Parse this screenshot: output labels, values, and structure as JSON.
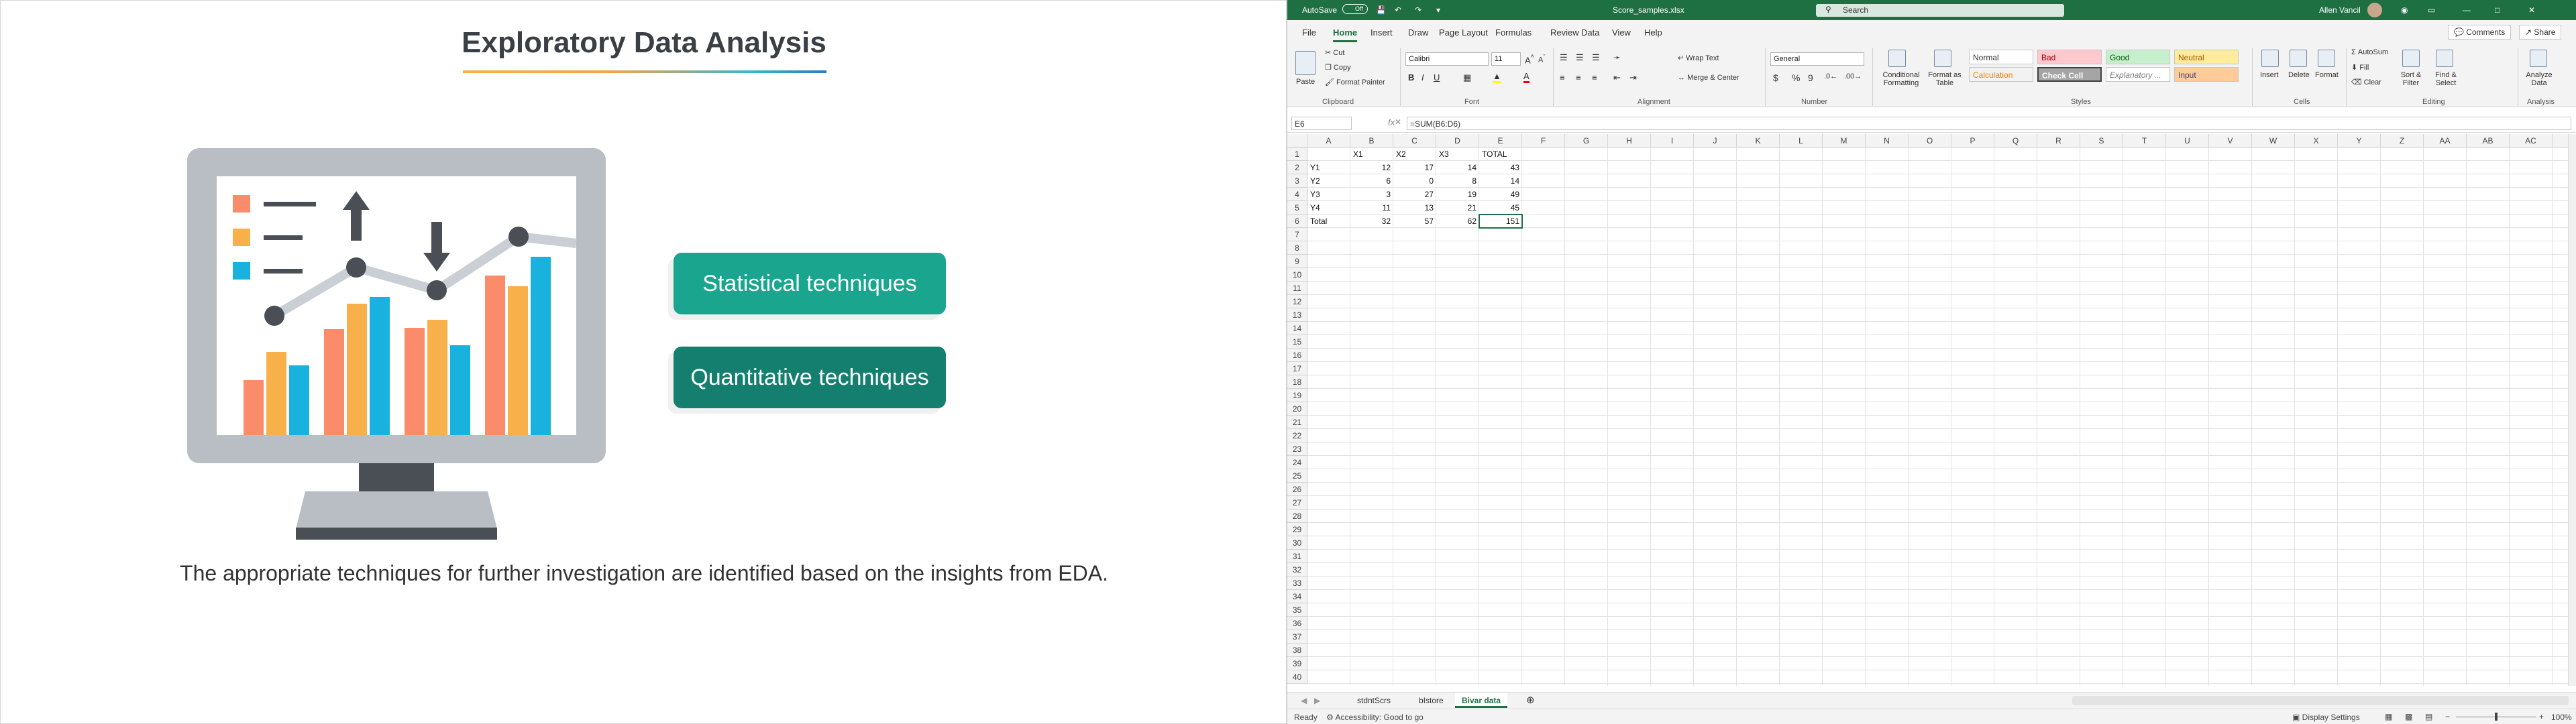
{
  "slide": {
    "title": "Exploratory Data Analysis",
    "button1": "Statistical techniques",
    "button2": "Quantitative techniques",
    "caption": "The appropriate techniques for further investigation are identified based on the insights from EDA.",
    "colors": {
      "pill1": "#1aa58f",
      "pill2": "#147f6f",
      "orange": "#f7b04a",
      "salmon": "#fa8c6c",
      "cyan": "#19b2df",
      "monitor": "#b8bec3",
      "dark": "#4a4f55"
    }
  },
  "excel": {
    "title": {
      "autosave": "AutoSave",
      "autosave_state": "Off",
      "filename": "Score_samples.xlsx",
      "search": "Search",
      "user": "Allen Vancil"
    },
    "menu": [
      "File",
      "Home",
      "Insert",
      "Draw",
      "Page Layout",
      "Formulas",
      "Data",
      "Review",
      "View",
      "Help"
    ],
    "actions": {
      "comments": "Comments",
      "share": "Share"
    },
    "ribbon": {
      "clipboard": {
        "paste": "Paste",
        "cut": "Cut",
        "copy": "Copy",
        "format_painter": "Format Painter",
        "label": "Clipboard"
      },
      "font": {
        "name": "Calibri",
        "size": "11",
        "label": "Font"
      },
      "alignment": {
        "wrap": "Wrap Text",
        "merge": "Merge & Center",
        "label": "Alignment"
      },
      "number": {
        "format": "General",
        "label": "Number"
      },
      "styles": {
        "conditional": "Conditional Formatting",
        "format_table": "Format as Table",
        "normal": "Normal",
        "bad": "Bad",
        "good": "Good",
        "neutral": "Neutral",
        "calculation": "Calculation",
        "check": "Check Cell",
        "explanatory": "Explanatory ...",
        "input": "Input",
        "label": "Styles"
      },
      "cells": {
        "insert": "Insert",
        "delete": "Delete",
        "format": "Format",
        "label": "Cells"
      },
      "editing": {
        "autosum": "AutoSum",
        "fill": "Fill",
        "clear": "Clear",
        "sort": "Sort & Filter",
        "find": "Find & Select",
        "label": "Editing"
      },
      "analysis": {
        "analyze": "Analyze Data",
        "label": "Analysis"
      }
    },
    "formula_bar": {
      "name_box": "E6",
      "fx": "fx",
      "formula": "=SUM(B6:D6)"
    },
    "columns": [
      "A",
      "B",
      "C",
      "D",
      "E",
      "F",
      "G",
      "H",
      "I",
      "J",
      "K",
      "L",
      "M",
      "N",
      "O",
      "P",
      "Q",
      "R",
      "S",
      "T",
      "U",
      "V",
      "W",
      "X",
      "Y",
      "Z",
      "AA",
      "AB",
      "AC"
    ],
    "rows": [
      "1",
      "2",
      "3",
      "4",
      "5",
      "6",
      "7",
      "8",
      "9",
      "10",
      "11",
      "12",
      "13",
      "14",
      "15",
      "16",
      "17",
      "18",
      "19",
      "20",
      "21",
      "22",
      "23",
      "24",
      "25",
      "26",
      "27",
      "28",
      "29",
      "30",
      "31",
      "32",
      "33",
      "34",
      "35",
      "36",
      "37",
      "38",
      "39",
      "40"
    ],
    "table": {
      "header": [
        "",
        "X1",
        "X2",
        "X3",
        "TOTAL"
      ],
      "body": [
        [
          "Y1",
          "12",
          "17",
          "14",
          "43"
        ],
        [
          "Y2",
          "6",
          "0",
          "8",
          "14"
        ],
        [
          "Y3",
          "3",
          "27",
          "19",
          "49"
        ],
        [
          "Y4",
          "11",
          "13",
          "21",
          "45"
        ],
        [
          "Total",
          "32",
          "57",
          "62",
          "151"
        ]
      ]
    },
    "sheets": [
      "stdntScrs",
      "bIstore",
      "Bivar data"
    ],
    "status": {
      "ready": "Ready",
      "accessibility": "Accessibility: Good to go",
      "display": "Display Settings",
      "zoom": "100%"
    },
    "accent": "#1e6f42"
  }
}
